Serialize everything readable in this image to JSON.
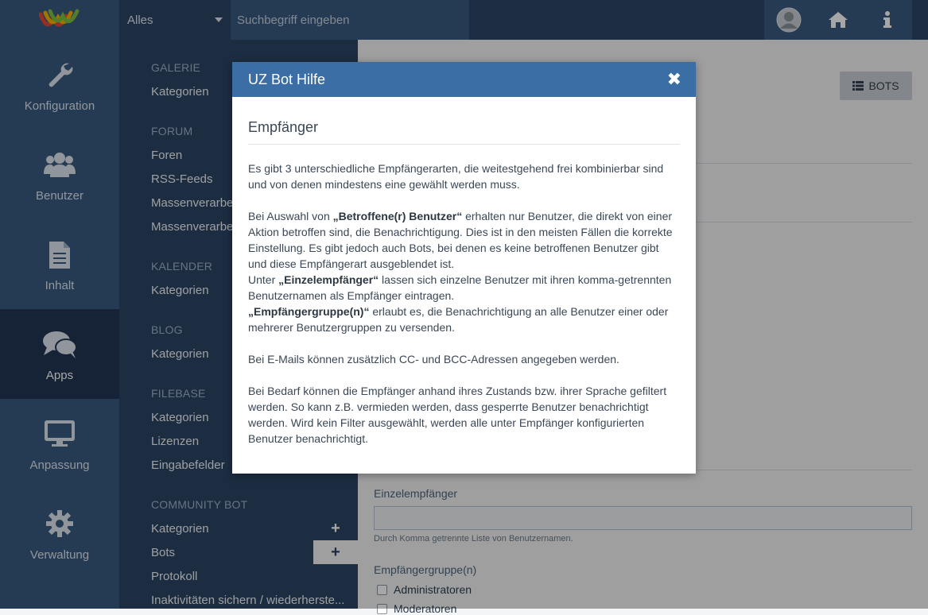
{
  "topbar": {
    "search_scope": "Alles",
    "search_placeholder": "Suchbegriff eingeben"
  },
  "main_menu": [
    {
      "label": "Konfiguration",
      "icon": "wrench-icon"
    },
    {
      "label": "Benutzer",
      "icon": "users-icon"
    },
    {
      "label": "Inhalt",
      "icon": "file-icon"
    },
    {
      "label": "Apps",
      "icon": "comments-icon",
      "active": true
    },
    {
      "label": "Anpassung",
      "icon": "desktop-icon"
    },
    {
      "label": "Verwaltung",
      "icon": "gear-icon"
    }
  ],
  "submenu": {
    "galerie": {
      "head": "GALERIE",
      "items": [
        "Kategorien"
      ]
    },
    "forum": {
      "head": "FORUM",
      "items": [
        "Foren",
        "RSS-Feeds",
        "Massenverarbeitung",
        "Massenverarbeitung"
      ]
    },
    "kalender": {
      "head": "KALENDER",
      "items": [
        "Kategorien"
      ]
    },
    "blog": {
      "head": "BLOG",
      "items": [
        "Kategorien"
      ]
    },
    "filebase": {
      "head": "FILEBASE",
      "items": [
        "Kategorien",
        "Lizenzen",
        "Eingabefelder"
      ]
    },
    "community_bot": {
      "head": "COMMUNITY BOT",
      "items": [
        "Kategorien",
        "Bots",
        "Protokoll",
        "Inaktivitäten sichern / wiederherste..."
      ]
    }
  },
  "content": {
    "bots_button": "BOTS",
    "einzel_label": "Einzelempfänger",
    "einzel_hint": "Durch Komma getrennte Liste von Benutzernamen.",
    "gruppe_label": "Empfängergruppe(n)",
    "gruppen": [
      "Administratoren",
      "Moderatoren"
    ]
  },
  "dialog": {
    "title": "UZ Bot Hilfe",
    "section": "Empfänger",
    "p1": "Es gibt 3 unterschiedliche Empfängerarten, die weitestgehend frei kombinierbar sind und von denen mindestens eine gewählt werden muss.",
    "p2_pre": "Bei Auswahl von ",
    "p2_b": "„Betroffene(r) Benutzer“",
    "p2_post": " erhalten nur Benutzer, die direkt von einer Aktion betroffen sind, die Benachrichtigung. Dies ist in den meisten Fällen die korrekte Einstellung. Es gibt jedoch auch Bots, bei denen es keine betroffenen Benutzer gibt und diese Empfängerart ausgeblendet ist.",
    "p3_pre": "Unter ",
    "p3_b": "„Einzelempfänger“",
    "p3_post": " lassen sich einzelne Benutzer mit ihren komma-getrennten Benutzernamen als Empfänger eintragen.",
    "p4_b": "„Empfängergruppe(n)“",
    "p4_post": " erlaubt es, die Benachrichtigung an alle Benutzer einer oder mehrerer Benutzergruppen zu versenden.",
    "p5": "Bei E-Mails können zusätzlich CC- und BCC-Adressen angegeben werden.",
    "p6": "Bei Bedarf können die Empfänger anhand ihres Zustands bzw. ihrer Sprache gefiltert werden. So kann z.B. vermieden werden, dass gesperrte Benutzer benachrichtigt werden. Wird kein Filter ausgewählt, werden alle unter Empfänger konfigurierten Benutzer benachrichtigt."
  }
}
